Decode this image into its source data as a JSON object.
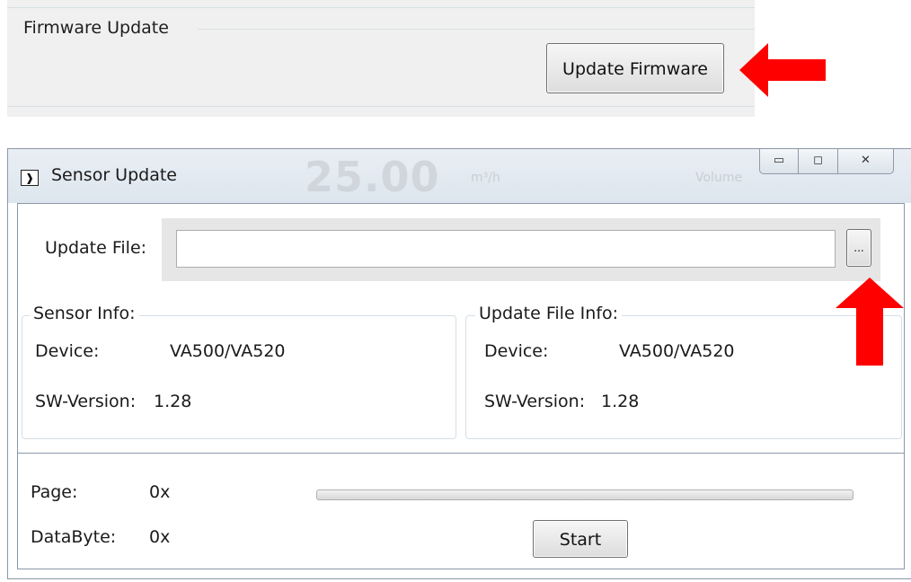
{
  "firmware_panel": {
    "group_title": "Firmware Update",
    "button_label": "Update Firmware"
  },
  "window": {
    "title": "Sensor Update",
    "icon_glyph": "❱",
    "background_reading": "25.00",
    "background_unit": "m³/h",
    "background_right": "Volume",
    "caption_buttons": {
      "minimize_glyph": "▭",
      "maximize_glyph": "◻",
      "close_glyph": "✕"
    }
  },
  "update_file": {
    "label": "Update File:",
    "value": "",
    "browse_label": "..."
  },
  "sensor_info": {
    "title": "Sensor Info:",
    "device_label": "Device:",
    "device_value": "VA500/VA520",
    "sw_label": "SW-Version:",
    "sw_value": "1.28"
  },
  "update_file_info": {
    "title": "Update File Info:",
    "device_label": "Device:",
    "device_value": "VA500/VA520",
    "sw_label": "SW-Version:",
    "sw_value": "1.28"
  },
  "status": {
    "page_label": "Page:",
    "page_value": "0x",
    "databyte_label": "DataByte:",
    "databyte_value": "0x",
    "progress_fraction": 0,
    "start_label": "Start"
  },
  "colors": {
    "annotation_arrow": "#ff0000",
    "titlebar": "#dde6ee",
    "panel_background": "#f0f0f0"
  },
  "icons": [
    "app-icon",
    "minimize-icon",
    "maximize-icon",
    "close-icon",
    "arrow-left-annotation",
    "arrow-up-annotation"
  ]
}
